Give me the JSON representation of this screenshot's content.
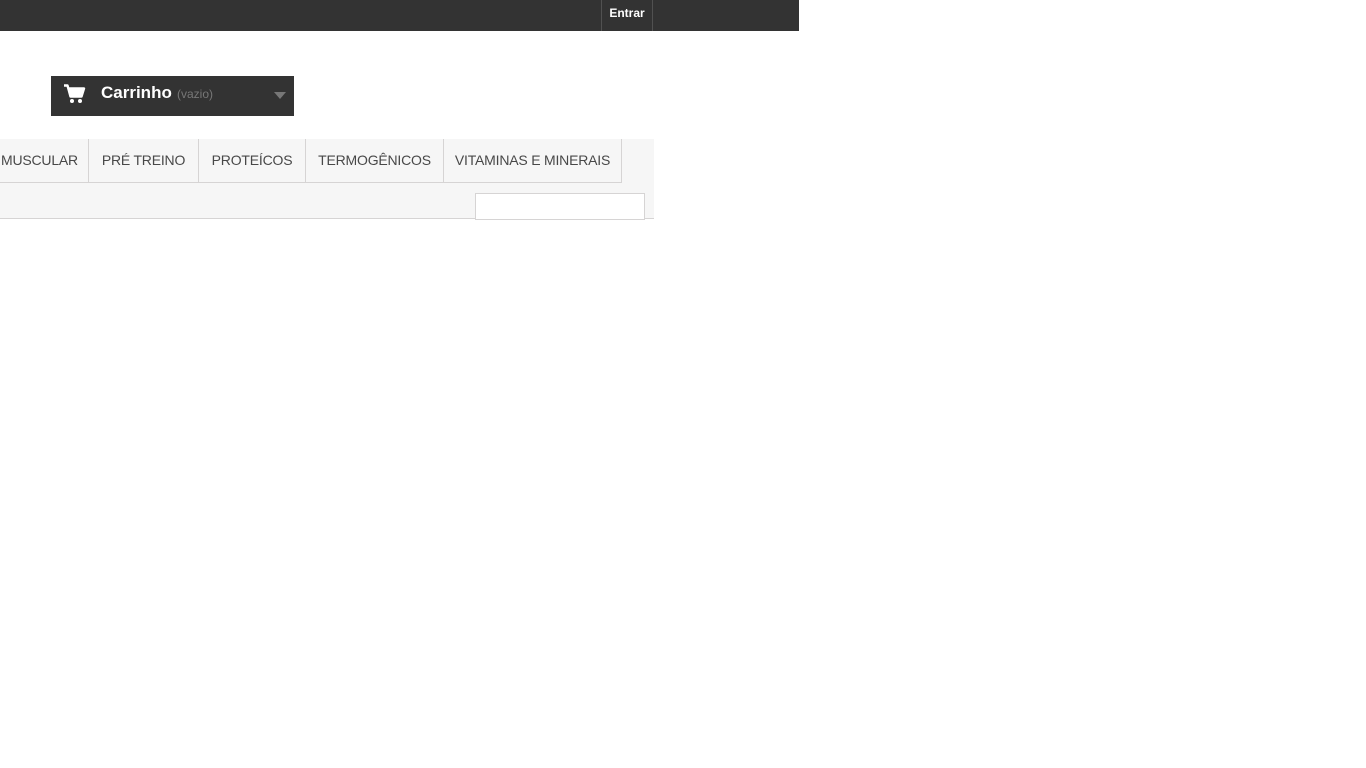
{
  "header": {
    "login_label": "Entrar"
  },
  "cart": {
    "label": "Carrinho",
    "status": "(vazio)",
    "icon": "shopping-cart-icon"
  },
  "menu": {
    "items": [
      {
        "label": "MUSCULAR"
      },
      {
        "label": "PRÉ TREINO"
      },
      {
        "label": "PROTEÍCOS"
      },
      {
        "label": "TERMOGÊNICOS"
      },
      {
        "label": "VITAMINAS E MINERAIS"
      }
    ]
  },
  "search": {
    "value": "",
    "placeholder": ""
  },
  "colors": {
    "dark_bar": "#333333",
    "menu_bg": "#f6f6f6",
    "border": "#d6d4d4",
    "menu_text": "#484848",
    "muted": "#777777"
  }
}
